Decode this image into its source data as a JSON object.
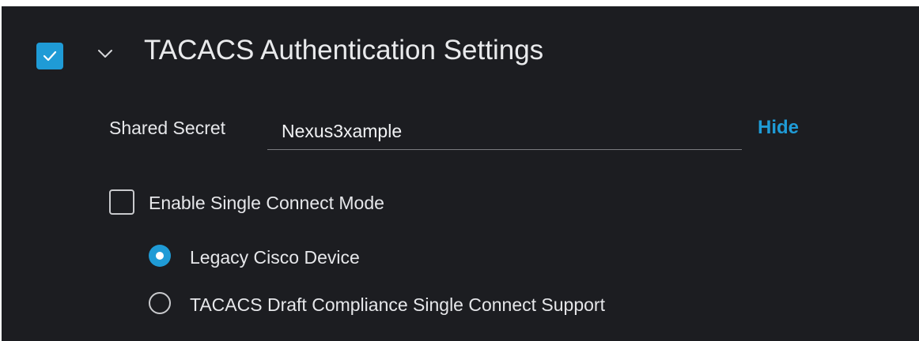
{
  "section": {
    "title": "TACACS Authentication Settings",
    "enabled": true,
    "expanded": true
  },
  "shared_secret": {
    "label": "Shared Secret",
    "value": "Nexus3xample",
    "toggle_label": "Hide"
  },
  "single_connect": {
    "label": "Enable Single Connect Mode",
    "checked": false,
    "options": [
      {
        "label": "Legacy Cisco Device",
        "selected": true
      },
      {
        "label": "TACACS Draft Compliance Single Connect Support",
        "selected": false
      }
    ]
  },
  "colors": {
    "accent": "#1f9bd6",
    "background": "#1c1d21",
    "text": "#e6e7ea"
  },
  "icons": [
    "checkmark-icon",
    "chevron-down-icon"
  ]
}
